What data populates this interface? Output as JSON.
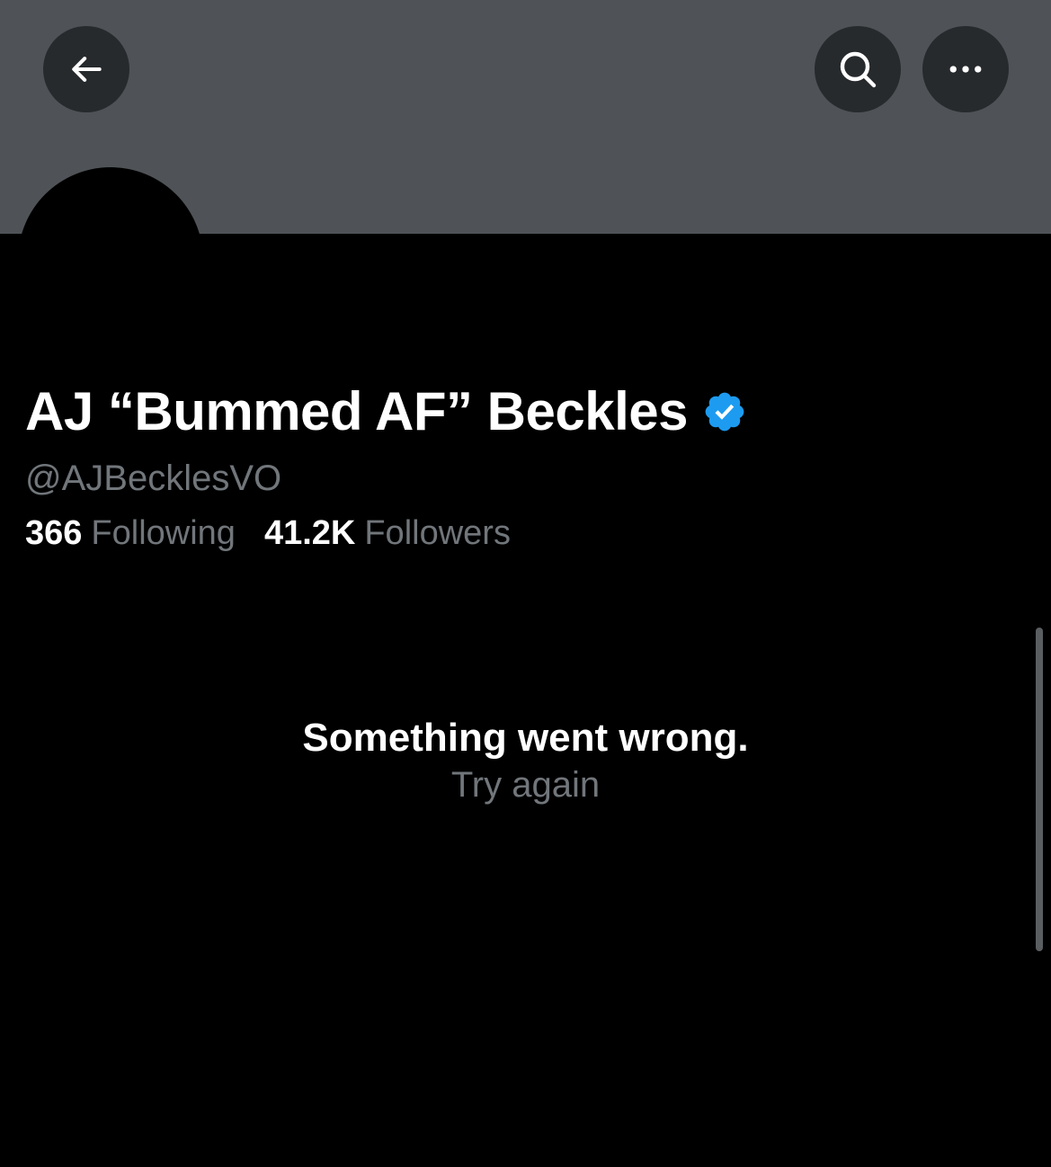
{
  "profile": {
    "display_name": "AJ “Bummed AF” Beckles",
    "handle": "@AJBecklesVO",
    "verified": true,
    "following_count": "366",
    "following_label": "Following",
    "followers_count": "41.2K",
    "followers_label": "Followers"
  },
  "error": {
    "title": "Something went wrong.",
    "retry_label": "Try again"
  },
  "icons": {
    "back": "arrow-left-icon",
    "search": "search-icon",
    "more": "more-horizontal-icon",
    "verified": "verified-badge-icon"
  },
  "colors": {
    "background": "#000000",
    "banner": "#4f5357",
    "button_bg": "#272a2d",
    "text_primary": "#ffffff",
    "text_secondary": "#71767b",
    "verified_blue": "#1d9bf0"
  }
}
